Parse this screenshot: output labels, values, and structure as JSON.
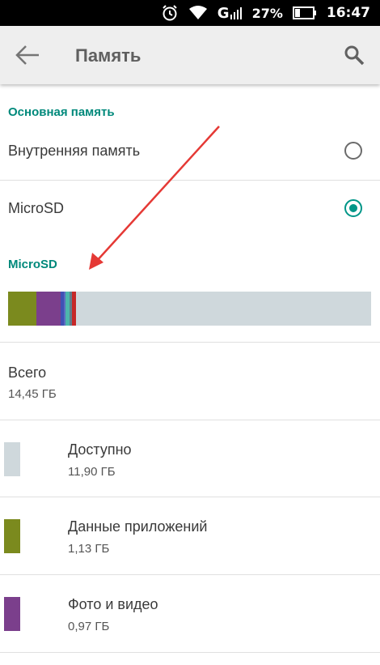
{
  "status_bar": {
    "signal_text": "G",
    "battery": "27%",
    "time": "16:47"
  },
  "toolbar": {
    "title": "Память",
    "back_icon": "arrow-left-icon",
    "search_icon": "search-icon"
  },
  "sections": {
    "primary_header": "Основная память",
    "microsd_header": "MicroSD"
  },
  "storage_options": [
    {
      "label": "Внутренняя память",
      "selected": false
    },
    {
      "label": "MicroSD",
      "selected": true
    }
  ],
  "storage_bar": {
    "segments": [
      {
        "fraction": 0.078,
        "color": "#7b8a1e"
      },
      {
        "fraction": 0.067,
        "color": "#7b3f8c"
      },
      {
        "fraction": 0.008,
        "color": "#3f51b5"
      },
      {
        "fraction": 0.006,
        "color": "#5c6bc0"
      },
      {
        "fraction": 0.01,
        "color": "#4db6ac"
      },
      {
        "fraction": 0.006,
        "color": "#607d8b"
      },
      {
        "fraction": 0.012,
        "color": "#c62828"
      }
    ],
    "remaining_color": "#cfd8dc"
  },
  "total": {
    "label": "Всего",
    "value": "14,45 ГБ"
  },
  "categories": [
    {
      "name": "Доступно",
      "size": "11,90 ГБ",
      "color": "#cfd8dc"
    },
    {
      "name": "Данные приложений",
      "size": "1,13 ГБ",
      "color": "#7b8a1e"
    },
    {
      "name": "Фото и видео",
      "size": "0,97 ГБ",
      "color": "#7b3f8c"
    }
  ],
  "colors": {
    "accent": "#009688",
    "annotation_arrow": "#e53935"
  }
}
